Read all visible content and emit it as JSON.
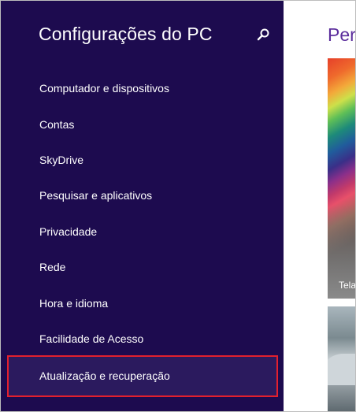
{
  "sidebar": {
    "title": "Configurações do PC",
    "search_icon": "magnifier-icon",
    "items": [
      {
        "label": "Computador e dispositivos"
      },
      {
        "label": "Contas"
      },
      {
        "label": "SkyDrive"
      },
      {
        "label": "Pesquisar e aplicativos"
      },
      {
        "label": "Privacidade"
      },
      {
        "label": "Rede"
      },
      {
        "label": "Hora e idioma"
      },
      {
        "label": "Facilidade de Acesso"
      },
      {
        "label": "Atualização e recuperação",
        "selected": true
      }
    ]
  },
  "main": {
    "title": "Pers",
    "tile_label": "Tela"
  },
  "colors": {
    "sidebar_bg": "#1d0b4f",
    "highlight_border": "#e2202e",
    "accent_title": "#5b2d9c"
  }
}
